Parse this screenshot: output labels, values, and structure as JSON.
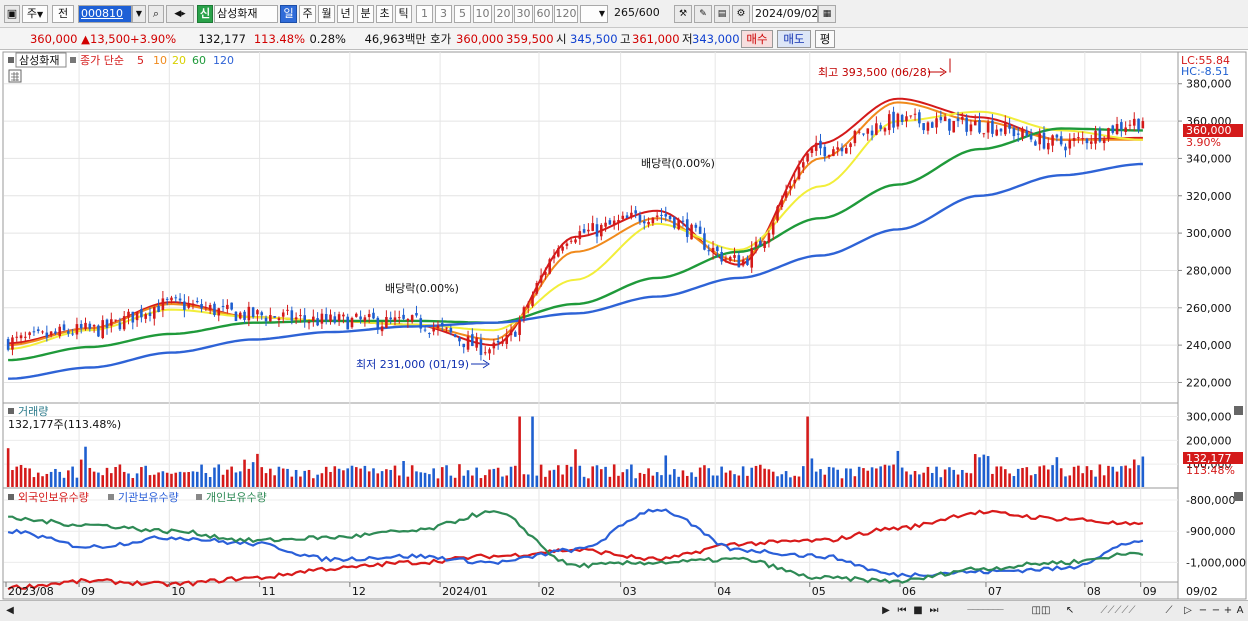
{
  "toolbar": {
    "period_label": "주",
    "prev_label": "전",
    "code_value": "000810",
    "new_badge": "신",
    "stock_name": "삼성화재",
    "tabs": [
      "일",
      "주",
      "월",
      "년",
      "분",
      "초",
      "틱"
    ],
    "active_tab": "일",
    "intervals": [
      "1",
      "3",
      "5",
      "10",
      "20",
      "30",
      "60",
      "120"
    ],
    "count_display": "265",
    "count_total": "/600",
    "date_value": "2024/09/02"
  },
  "info": {
    "price": "360,000",
    "change": "13,500",
    "change_pct": "+3.90%",
    "volume": "132,177",
    "volume_ratio": "113.48%",
    "turnover_pct": "0.28%",
    "amount": "46,963백만",
    "quote_label": "호가",
    "ask": "360,000",
    "bid": "359,500",
    "open_label": "시",
    "open": "345,500",
    "high_label": "고",
    "high": "361,000",
    "low_label": "저",
    "low": "343,000",
    "buy_label": "매수",
    "sell_label": "매도",
    "eval_label": "평"
  },
  "price_panel": {
    "stock_label": "삼성화재",
    "ma_prefix": "종가 단순",
    "lc_label": "LC:55.84",
    "hc_label": "HC:-8.51",
    "current_price_tag": "360,000",
    "current_pct_tag": "3.90%",
    "annotations": {
      "high": "최고 393,500 (06/28)",
      "low": "최저 231,000 (01/19)",
      "dividend1": "배당락(0.00%)",
      "dividend2": "배당락(0.00%)"
    }
  },
  "volume_panel": {
    "title": "거래량",
    "summary": "132,177주(113.48%)",
    "tag_value": "132,177",
    "tag_pct": "113.48%"
  },
  "holdings_panel": {
    "legend": [
      "외국인보유수량",
      "기관보유수량",
      "개인보유수량"
    ]
  },
  "x_axis": {
    "labels": [
      "2023/08",
      "09",
      "10",
      "11",
      "12",
      "2024/01",
      "02",
      "03",
      "04",
      "05",
      "06",
      "07",
      "08",
      "09"
    ],
    "end_label": "09/02"
  },
  "colors": {
    "up": "#d41a1a",
    "down": "#1e5fd0",
    "ma5": "#d41a1a",
    "ma10": "#f08a1c",
    "ma20": "#f2ee3a",
    "ma60": "#1f9a3a",
    "ma120": "#2e63d6",
    "foreign": "#d81a1a",
    "institution": "#2a5fd8",
    "individual": "#2e8a55"
  },
  "chart_data": [
    {
      "type": "candlestick",
      "title": "삼성화재",
      "x": [
        "2023/08",
        "09",
        "10",
        "11",
        "12",
        "2024/01",
        "02",
        "03",
        "04",
        "05",
        "06",
        "07",
        "08",
        "09"
      ],
      "series": [
        {
          "name": "종가",
          "values": [
            242000,
            248000,
            262000,
            256000,
            253000,
            252000,
            238000,
            300000,
            310000,
            285000,
            345000,
            360000,
            358000,
            348000,
            360000
          ]
        },
        {
          "name": "5",
          "values": [
            241000,
            249000,
            263000,
            255000,
            253000,
            251000,
            240000,
            298000,
            312000,
            283000,
            348000,
            372000,
            362000,
            350000,
            351000
          ]
        },
        {
          "name": "10",
          "values": [
            240000,
            249000,
            262000,
            255000,
            253000,
            251000,
            243000,
            290000,
            308000,
            285000,
            340000,
            370000,
            360000,
            350000,
            350000
          ]
        },
        {
          "name": "20",
          "values": [
            238000,
            248000,
            259000,
            255000,
            253000,
            251000,
            248000,
            275000,
            305000,
            291000,
            325000,
            360000,
            365000,
            355000,
            350000
          ]
        },
        {
          "name": "60",
          "values": [
            232000,
            239000,
            246000,
            252000,
            253000,
            253000,
            252000,
            262000,
            276000,
            290000,
            308000,
            326000,
            345000,
            356000,
            355000
          ]
        },
        {
          "name": "120",
          "values": [
            222000,
            228000,
            236000,
            243000,
            247000,
            250000,
            252000,
            257000,
            266000,
            276000,
            288000,
            302000,
            320000,
            331000,
            337000
          ]
        }
      ],
      "high": {
        "value": 393500,
        "date": "06/28"
      },
      "low": {
        "value": 231000,
        "date": "01/19"
      },
      "last": 360000,
      "y_ticks": [
        220000,
        240000,
        260000,
        280000,
        300000,
        320000,
        340000,
        360000,
        380000
      ],
      "ylim": [
        209000,
        397000
      ]
    },
    {
      "type": "bar",
      "title": "거래량",
      "last_value": 132177,
      "ratio": "113.48%",
      "y_ticks": [
        100000,
        200000,
        300000
      ],
      "peaks": [
        {
          "month": "02",
          "value": 310000
        },
        {
          "month": "05",
          "value": 310000
        }
      ]
    },
    {
      "type": "line",
      "series_names": [
        "외국인보유수량",
        "기관보유수량",
        "개인보유수량"
      ],
      "y_ticks": [
        -800000,
        -900000,
        -1000000
      ]
    }
  ]
}
